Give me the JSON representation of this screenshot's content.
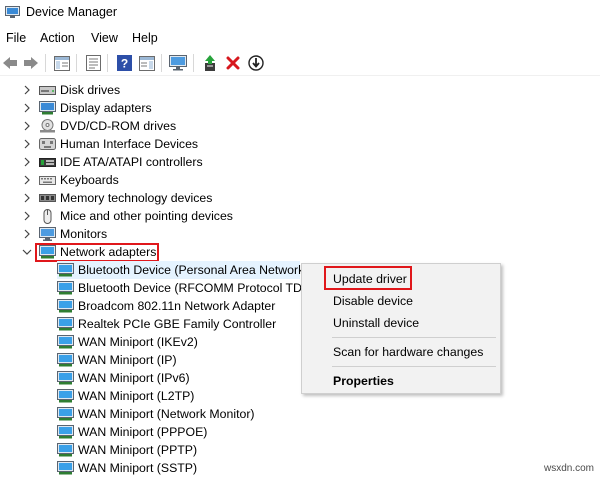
{
  "window": {
    "title": "Device Manager"
  },
  "menubar": {
    "items": [
      "File",
      "Action",
      "View",
      "Help"
    ]
  },
  "toolbar": {
    "buttons": [
      "back-icon",
      "forward-icon",
      "show-hide-tree-icon",
      "properties-icon",
      "help-icon",
      "action-pane-icon",
      "monitor-scan-icon",
      "update-driver-icon",
      "uninstall-icon",
      "disable-device-icon"
    ]
  },
  "tree": {
    "categories": [
      {
        "label": "Disk drives",
        "icon": "disk-drive-icon",
        "expanded": false
      },
      {
        "label": "Display adapters",
        "icon": "display-adapter-icon",
        "expanded": false
      },
      {
        "label": "DVD/CD-ROM drives",
        "icon": "dvd-drive-icon",
        "expanded": false
      },
      {
        "label": "Human Interface Devices",
        "icon": "hid-icon",
        "expanded": false
      },
      {
        "label": "IDE ATA/ATAPI controllers",
        "icon": "ide-controller-icon",
        "expanded": false
      },
      {
        "label": "Keyboards",
        "icon": "keyboard-icon",
        "expanded": false
      },
      {
        "label": "Memory technology devices",
        "icon": "memory-icon",
        "expanded": false
      },
      {
        "label": "Mice and other pointing devices",
        "icon": "mouse-icon",
        "expanded": false
      },
      {
        "label": "Monitors",
        "icon": "monitor-icon",
        "expanded": false
      },
      {
        "label": "Network adapters",
        "icon": "network-adapter-icon",
        "expanded": true
      }
    ],
    "network_children": [
      "Bluetooth Device (Personal Area Network)",
      "Bluetooth Device (RFCOMM Protocol TDI)",
      "Broadcom 802.11n Network Adapter",
      "Realtek PCIe GBE Family Controller",
      "WAN Miniport (IKEv2)",
      "WAN Miniport (IP)",
      "WAN Miniport (IPv6)",
      "WAN Miniport (L2TP)",
      "WAN Miniport (Network Monitor)",
      "WAN Miniport (PPPOE)",
      "WAN Miniport (PPTP)",
      "WAN Miniport (SSTP)"
    ]
  },
  "context_menu": {
    "items": [
      "Update driver",
      "Disable device",
      "Uninstall device",
      "Scan for hardware changes",
      "Properties"
    ]
  },
  "watermark": "wsxdn.com",
  "colors": {
    "highlight_box": "#e0171b",
    "selection": "#e5f3ff",
    "menu_bg": "#f2f2f2"
  }
}
